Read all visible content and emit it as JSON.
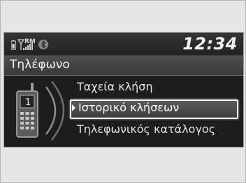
{
  "status": {
    "clock": "12:34",
    "roaming_label": "RM",
    "icons": [
      "phone-battery-icon",
      "signal-strength-icon",
      "bluetooth-icon"
    ]
  },
  "screen": {
    "title": "Τηλέφωνο",
    "phone_icon_line": "1",
    "menu": {
      "items": [
        {
          "label": "Ταχεία κλήση",
          "selected": false
        },
        {
          "label": "Ιστορικό κλήσεων",
          "selected": true
        },
        {
          "label": "Τηλεφωνικός κατάλογος",
          "selected": false
        }
      ]
    }
  },
  "colors": {
    "screen_background": "#1d1d1d",
    "highlight_border": "#ffffff",
    "text": "#e2e2e2"
  }
}
